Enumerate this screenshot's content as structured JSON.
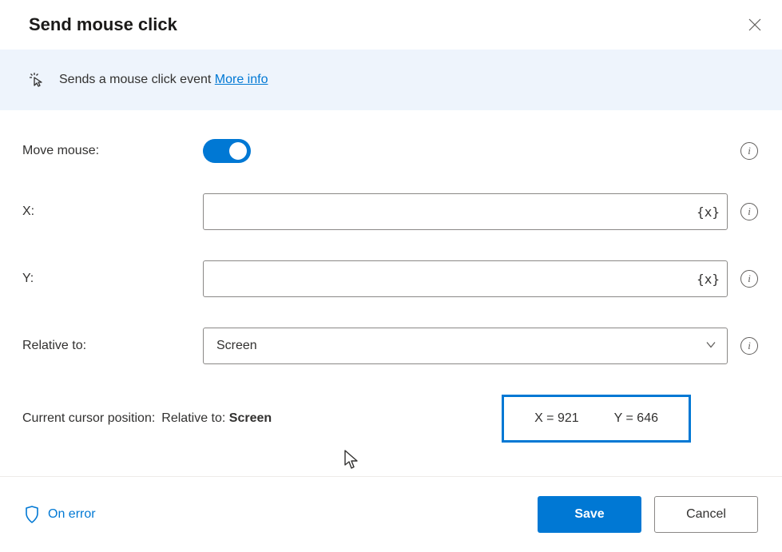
{
  "dialog": {
    "title": "Send mouse click",
    "banner": {
      "text": "Sends a mouse click event ",
      "link": "More info"
    },
    "fields": {
      "move_mouse_label": "Move mouse:",
      "x_label": "X:",
      "x_value": "",
      "y_label": "Y:",
      "y_value": "",
      "relative_to_label": "Relative to:",
      "relative_to_value": "Screen"
    },
    "cursor_position": {
      "label": "Current cursor position:",
      "relative_to_prefix": "Relative to: ",
      "relative_to_value": "Screen",
      "x_label": "X = ",
      "x_value": "921",
      "y_label": "Y = ",
      "y_value": "646"
    },
    "var_icon_text": "{x}",
    "footer": {
      "on_error": "On error",
      "save": "Save",
      "cancel": "Cancel"
    }
  }
}
